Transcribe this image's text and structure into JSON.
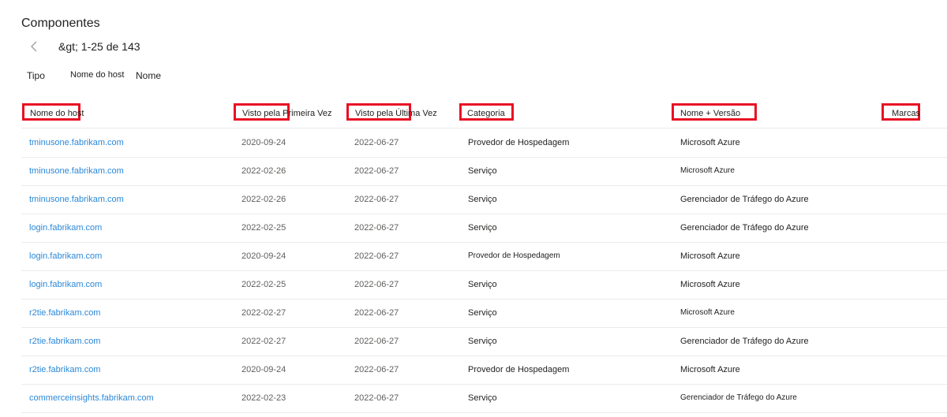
{
  "page": {
    "title": "Componentes",
    "pager": {
      "range": "&gt; 1-25 de 143"
    },
    "filters": [
      "Tipo",
      "Nome do host",
      "Nome"
    ]
  },
  "table": {
    "columns": [
      "Nome do host",
      "Visto pela Primeira Vez",
      "Visto pela Última Vez",
      "Categoria",
      "Nome + Versão",
      "Marcas"
    ],
    "rows": [
      {
        "host": "tminusone.fabrikam.com",
        "first_seen": "2020-09-24",
        "last_seen": "2022-06-27",
        "category": "Provedor de Hospedagem",
        "name_version": "Microsoft Azure"
      },
      {
        "host": "tminusone.fabrikam.com",
        "first_seen": "2022-02-26",
        "last_seen": "2022-06-27",
        "category": "Serviço",
        "name_version": "Microsoft Azure"
      },
      {
        "host": "tminusone.fabrikam.com",
        "first_seen": "2022-02-26",
        "last_seen": "2022-06-27",
        "category": "Serviço",
        "name_version": "Gerenciador de Tráfego do Azure"
      },
      {
        "host": "login.fabrikam.com",
        "first_seen": "2022-02-25",
        "last_seen": "2022-06-27",
        "category": "Serviço",
        "name_version": "Gerenciador de Tráfego do Azure"
      },
      {
        "host": "login.fabrikam.com",
        "first_seen": "2020-09-24",
        "last_seen": "2022-06-27",
        "category": "Provedor de Hospedagem",
        "name_version": "Microsoft Azure"
      },
      {
        "host": "login.fabrikam.com",
        "first_seen": "2022-02-25",
        "last_seen": "2022-06-27",
        "category": "Serviço",
        "name_version": "Microsoft Azure"
      },
      {
        "host": "r2tie.fabrikam.com",
        "first_seen": "2022-02-27",
        "last_seen": "2022-06-27",
        "category": "Serviço",
        "name_version": "Microsoft Azure"
      },
      {
        "host": "r2tie.fabrikam.com",
        "first_seen": "2022-02-27",
        "last_seen": "2022-06-27",
        "category": "Serviço",
        "name_version": "Gerenciador de Tráfego do Azure"
      },
      {
        "host": "r2tie.fabrikam.com",
        "first_seen": "2020-09-24",
        "last_seen": "2022-06-27",
        "category": "Provedor de Hospedagem",
        "name_version": "Microsoft Azure"
      },
      {
        "host": "commerceinsights.fabrikam.com",
        "first_seen": "2022-02-23",
        "last_seen": "2022-06-27",
        "category": "Serviço",
        "name_version": "Gerenciador de Tráfego do Azure"
      }
    ]
  },
  "colors": {
    "highlight": "#e81123",
    "link": "#2b88d8",
    "text": "#201f1e",
    "muted": "#605e5c",
    "divider": "#edebe9"
  },
  "icons": {
    "prev": "chevron-left-icon"
  }
}
